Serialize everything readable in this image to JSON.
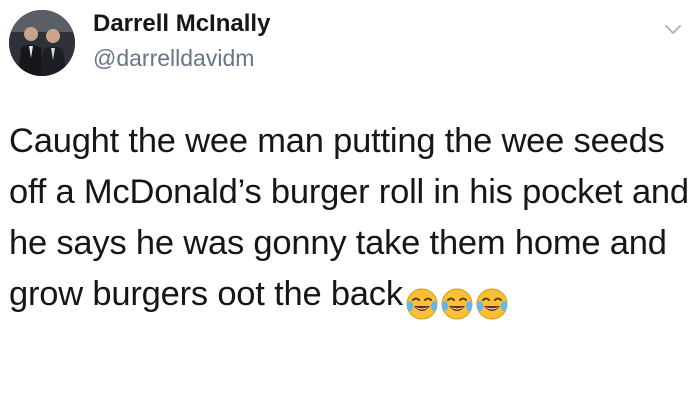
{
  "tweet": {
    "author_name": "Darrell McInally",
    "author_handle": "@darrelldavidm",
    "text": "Caught the wee man putting the wee seeds off a McDonald’s burger roll in his pocket and he says he was gonny take them home and grow burgers oot the back",
    "emojis": [
      "face-with-tears-of-joy",
      "face-with-tears-of-joy",
      "face-with-tears-of-joy"
    ]
  },
  "colors": {
    "text_primary": "#14171a",
    "text_secondary": "#657786",
    "background": "#ffffff",
    "emoji_yellow": "#f7c136"
  },
  "icons": {
    "menu": "chevron-down-icon"
  }
}
